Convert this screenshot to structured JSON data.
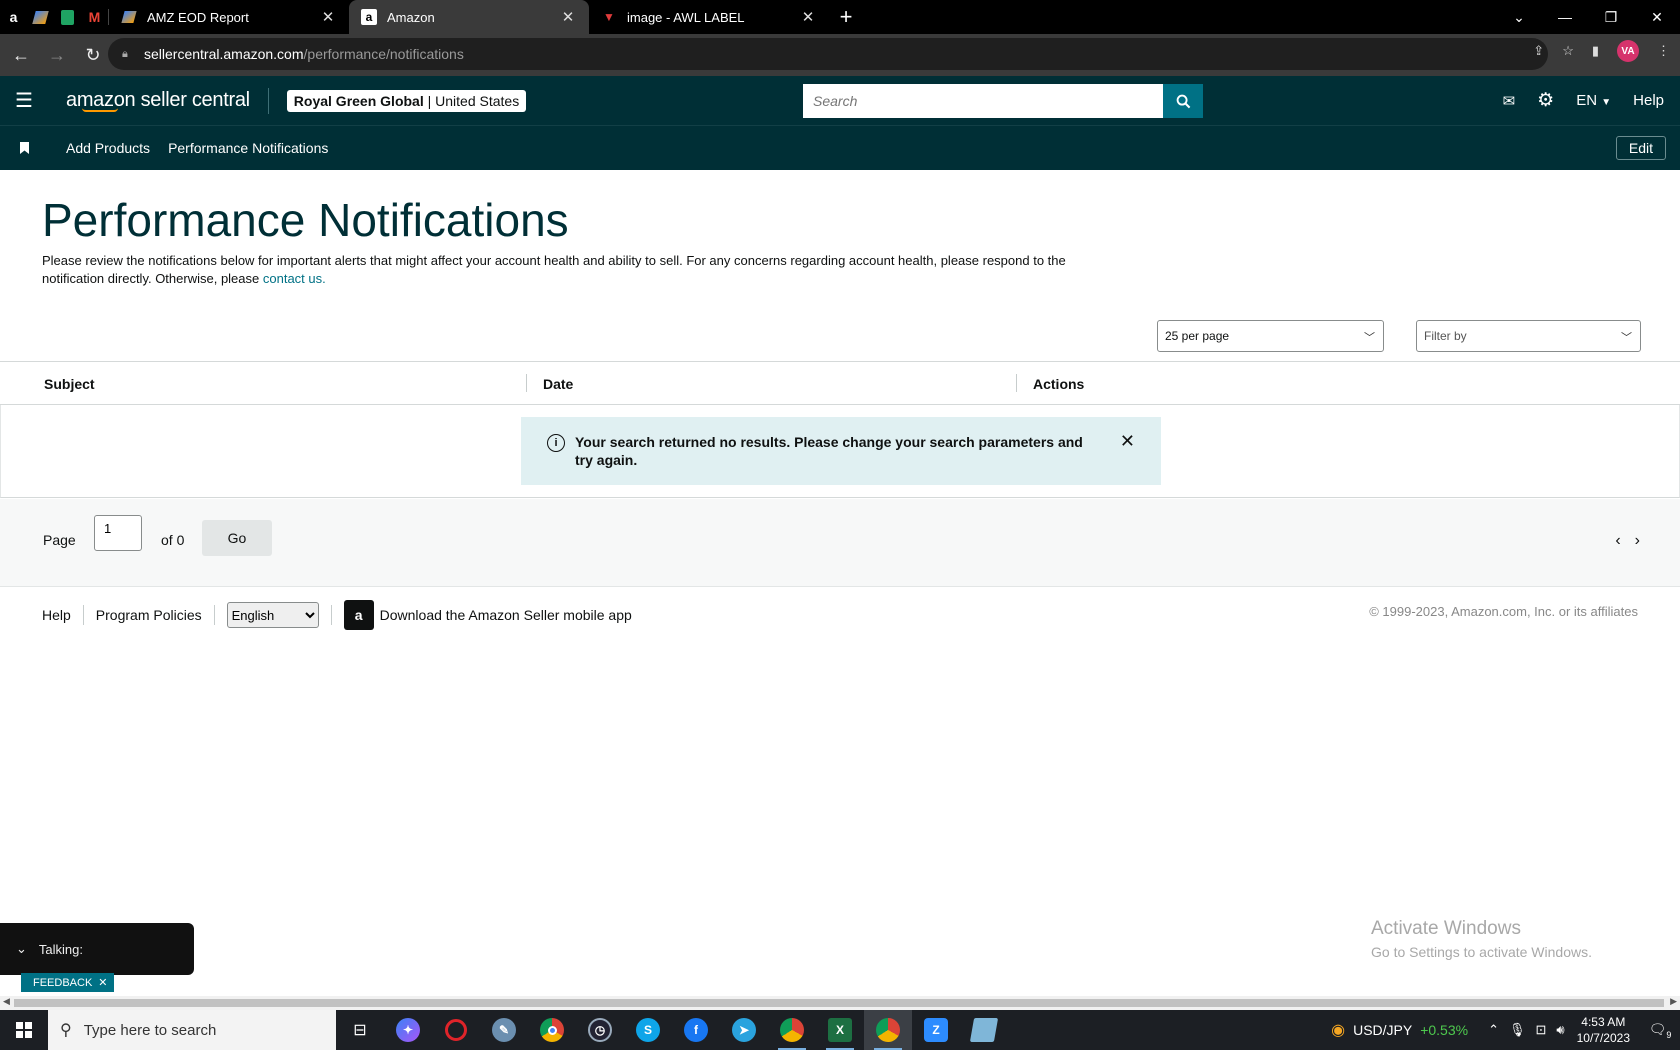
{
  "browser": {
    "pinned": [
      "a",
      "",
      "",
      "M"
    ],
    "tabs": [
      {
        "title": "AMZ EOD Report"
      },
      {
        "title": "Amazon"
      },
      {
        "title": "image - AWL LABEL"
      }
    ],
    "url_host": "sellercentral.amazon.com",
    "url_path": "/performance/notifications",
    "profile_initials": "VA"
  },
  "header": {
    "logo_text": "amazon seller central",
    "account_name": "Royal Green Global",
    "account_region": "United States",
    "search_placeholder": "Search",
    "language": "EN",
    "help": "Help"
  },
  "nav": {
    "links": [
      "Add Products",
      "Performance Notifications"
    ],
    "edit": "Edit"
  },
  "main": {
    "title": "Performance Notifications",
    "intro": "Please review the notifications below for important alerts that might affect your account health and ability to sell. For any concerns regarding account health, please respond to the notification directly. Otherwise, please ",
    "intro_link": "contact us.",
    "per_page": "25 per page",
    "filter": "Filter by",
    "columns": [
      "Subject",
      "Date",
      "Actions"
    ],
    "alert": "Your search returned no results. Please change your search parameters and try again.",
    "pager": {
      "page_label": "Page",
      "page_value": "1",
      "of_label": "of 0",
      "go": "Go"
    }
  },
  "footer": {
    "help": "Help",
    "policies": "Program Policies",
    "language": "English",
    "app": "Download the Amazon Seller mobile app",
    "copyright": "© 1999-2023, Amazon.com, Inc. or its affiliates"
  },
  "overlay": {
    "activate_title": "Activate Windows",
    "activate_sub": "Go to Settings to activate Windows.",
    "talking": "Talking:",
    "feedback": "FEEDBACK"
  },
  "taskbar": {
    "search_placeholder": "Type here to search",
    "fx_pair": "USD/JPY",
    "fx_change": "+0.53%",
    "time": "4:53 AM",
    "date": "10/7/2023",
    "notif_count": "9"
  }
}
